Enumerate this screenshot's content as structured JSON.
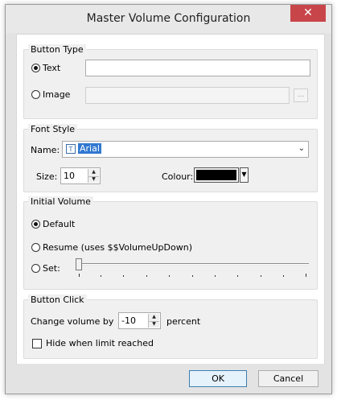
{
  "window": {
    "title": "Master Volume Configuration",
    "close_glyph": "✕"
  },
  "button_type": {
    "legend": "Button Type",
    "text_label": "Text",
    "text_value": "",
    "image_label": "Image",
    "image_value": "",
    "browse_label": "...",
    "selected": "Text"
  },
  "font_style": {
    "legend": "Font Style",
    "name_label": "Name:",
    "font_icon": "T",
    "font_value": "Arial",
    "size_label": "Size:",
    "size_value": "10",
    "colour_label": "Colour:",
    "colour_value": "#000000"
  },
  "initial_volume": {
    "legend": "Initial Volume",
    "default_label": "Default",
    "resume_label": "Resume (uses $$VolumeUpDown)",
    "set_label": "Set:",
    "selected": "Default",
    "slider_level": 0
  },
  "button_click": {
    "legend": "Button Click",
    "change_label": "Change volume by",
    "change_value": "-10",
    "percent_label": "percent",
    "hide_label": "Hide when limit reached",
    "hide_checked": false
  },
  "buttons": {
    "ok_label": "OK",
    "cancel_label": "Cancel"
  },
  "icons": {
    "close": "close-icon",
    "font": "truetype-font-icon",
    "dropdown": "chevron-down-icon",
    "spin": "spin-updown-icon"
  }
}
